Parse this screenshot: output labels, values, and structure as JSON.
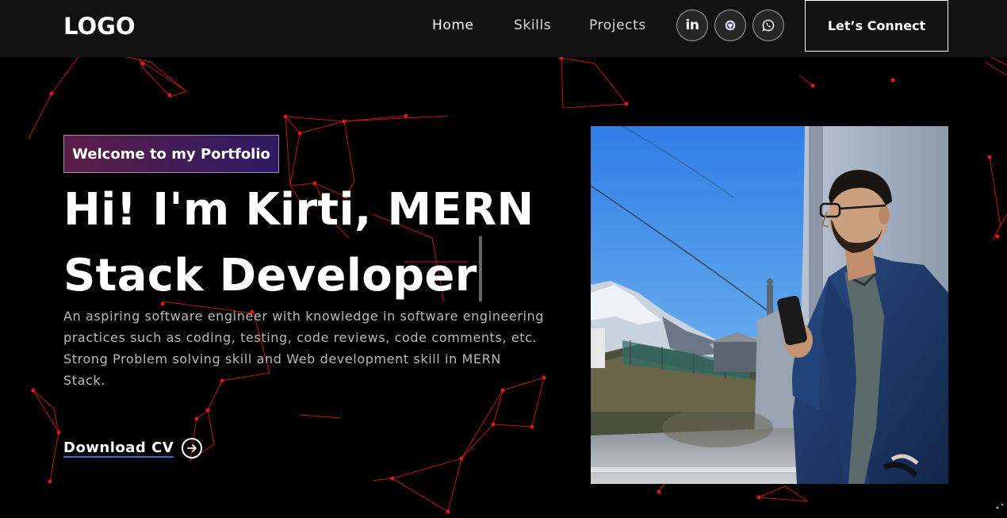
{
  "navbar": {
    "logo": "LOGO",
    "links": [
      {
        "label": "Home",
        "active": true
      },
      {
        "label": "Skills",
        "active": false
      },
      {
        "label": "Projects",
        "active": false
      }
    ],
    "social": [
      {
        "icon": "linkedin-icon",
        "text": "in"
      },
      {
        "icon": "github-icon"
      },
      {
        "icon": "whatsapp-icon"
      }
    ],
    "cta_label": "Let’s Connect"
  },
  "hero": {
    "tagline": "Welcome to my Portfolio",
    "headline_line1": "Hi! I'm Kirti, MERN",
    "headline_line2": "Stack Developer",
    "description": "An aspiring software engineer with knowledge in software engineering practices such as coding, testing, code reviews, code comments, etc. Strong Problem solving skill and Web development skill in MERN Stack.",
    "download_label": "Download CV",
    "download_icon": "arrow-right-circle-icon",
    "photo_alt": "profile-photo"
  },
  "colors": {
    "background": "#000000",
    "navbar_bg": "#121212",
    "particles": "#ff1a1a",
    "tagline_gradient_start": "#aa367c",
    "tagline_gradient_end": "#4a2fbd",
    "link_underline": "#2e6fe0"
  }
}
